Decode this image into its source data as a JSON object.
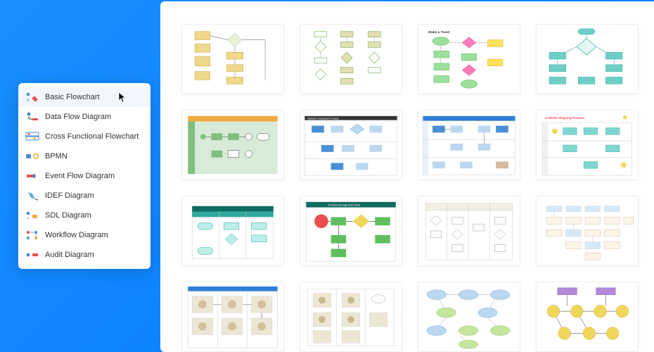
{
  "sidebar": {
    "items": [
      {
        "label": "Basic Flowchart",
        "active": true,
        "icon": "basic-flowchart"
      },
      {
        "label": "Data Flow Diagram",
        "active": false,
        "icon": "data-flow"
      },
      {
        "label": "Cross Functional Flowchart",
        "active": false,
        "icon": "cross-functional"
      },
      {
        "label": "BPMN",
        "active": false,
        "icon": "bpmn"
      },
      {
        "label": "Event Flow Diagram",
        "active": false,
        "icon": "event-flow"
      },
      {
        "label": "IDEF Diagram",
        "active": false,
        "icon": "idef"
      },
      {
        "label": "SDL Diagram",
        "active": false,
        "icon": "sdl"
      },
      {
        "label": "Workflow Diagram",
        "active": false,
        "icon": "workflow"
      },
      {
        "label": "Audit Diagram",
        "active": false,
        "icon": "audit"
      }
    ]
  },
  "colors": {
    "accent": "#007bff",
    "red": "#e94f50",
    "blue": "#2f7fd8",
    "orange": "#f0a940"
  },
  "gallery": {
    "templates": [
      {
        "name": "template-01",
        "title": "",
        "palette": [
          "#f0d88a",
          "#8bc88b",
          "#ffffff"
        ],
        "header": ""
      },
      {
        "name": "template-02",
        "title": "",
        "palette": [
          "#7fb25f",
          "#e2dfb3",
          "#ffffff"
        ],
        "header": ""
      },
      {
        "name": "template-03",
        "title": "Make a Toast",
        "palette": [
          "#9be09b",
          "#ff7bba",
          "#ffe15a"
        ],
        "header": ""
      },
      {
        "name": "template-04",
        "title": "",
        "palette": [
          "#6ecfc6",
          "#2fa9a0",
          "#ffffff"
        ],
        "header": ""
      },
      {
        "name": "template-05",
        "title": "",
        "palette": [
          "#7fbf7f",
          "#ffffff",
          "#d8ead8"
        ],
        "header": "#f0a940"
      },
      {
        "name": "template-06",
        "title": "Network Transaction Process",
        "palette": [
          "#4a8fd6",
          "#bcd7f0",
          "#ffffff"
        ],
        "header": "#000000"
      },
      {
        "name": "template-07",
        "title": "",
        "palette": [
          "#4a8fd6",
          "#bcd7f0",
          "#ffffff"
        ],
        "header": "#2f7fd8"
      },
      {
        "name": "template-08",
        "title": "Orderful Shipping Process",
        "palette": [
          "#7fd6cf",
          "#f7d65a",
          "#ffffff"
        ],
        "header": "#e94f50"
      },
      {
        "name": "template-09",
        "title": "",
        "palette": [
          "#2fa9a0",
          "#bceee8",
          "#ffffff"
        ],
        "header": "#0e6b62"
      },
      {
        "name": "template-10",
        "title": "Product storage flow chart",
        "palette": [
          "#e94f50",
          "#5fbf5f",
          "#f0d65a"
        ],
        "header": "#0e6b62"
      },
      {
        "name": "template-11",
        "title": "",
        "palette": [
          "#ece7d4",
          "#ffffff",
          "#ffffff"
        ],
        "header": "#ffffff"
      },
      {
        "name": "template-12",
        "title": "",
        "palette": [
          "#d6b9a0",
          "#bcd7f0",
          "#ffffff"
        ],
        "header": ""
      },
      {
        "name": "template-13",
        "title": "",
        "palette": [
          "#ece7d4",
          "#ffffff",
          "#ffffff"
        ],
        "header": "#2f7fd8"
      },
      {
        "name": "template-14",
        "title": "",
        "palette": [
          "#ece7d4",
          "#ffffff",
          "#ffffff"
        ],
        "header": ""
      },
      {
        "name": "template-15",
        "title": "",
        "palette": [
          "#bcd7f0",
          "#c6e6a0",
          "#ffffff"
        ],
        "header": ""
      },
      {
        "name": "template-16",
        "title": "",
        "palette": [
          "#f0d65a",
          "#b388d6",
          "#ffffff"
        ],
        "header": ""
      }
    ]
  }
}
